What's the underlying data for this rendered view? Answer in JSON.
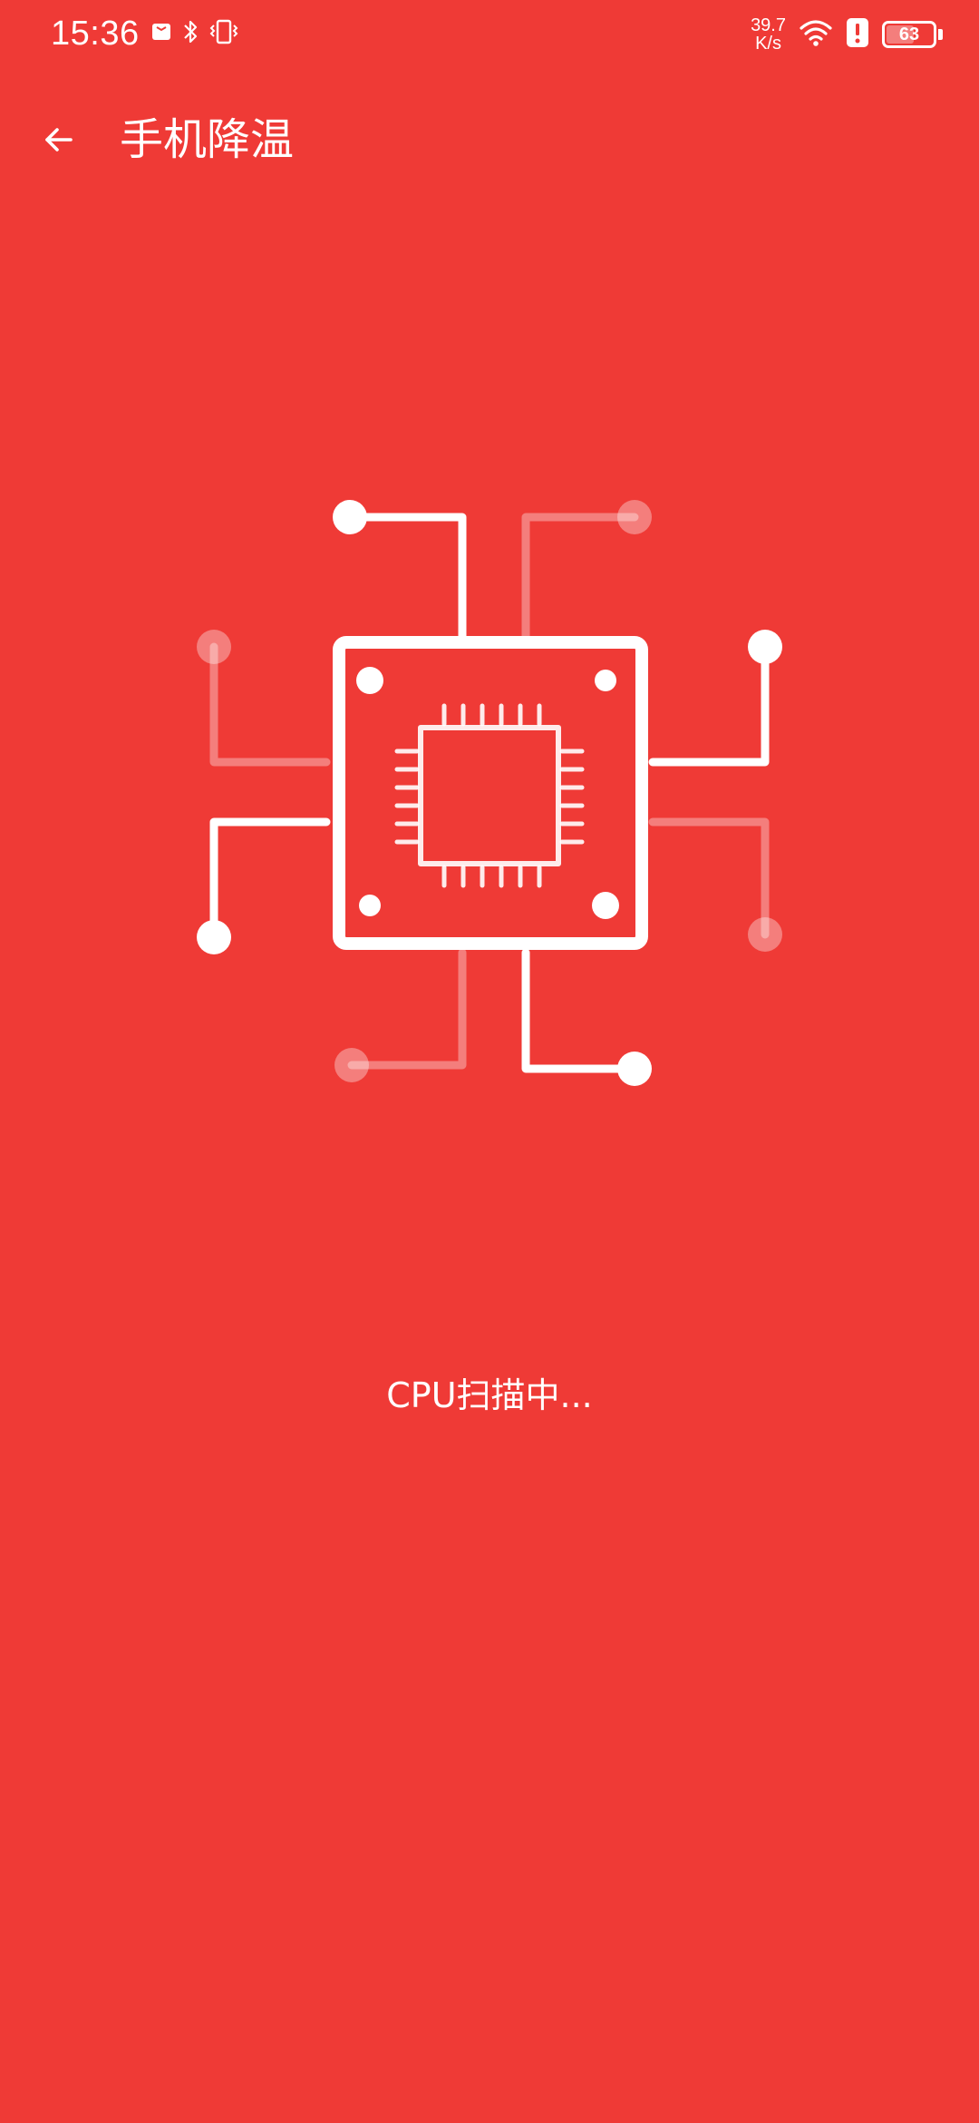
{
  "status_bar": {
    "time": "15:36",
    "net_speed_value": "39.7",
    "net_speed_unit": "K/s",
    "battery_level": "63",
    "icons": [
      "notification-icon",
      "bluetooth-icon",
      "vibrate-icon",
      "wifi-icon",
      "alert-icon",
      "battery-icon"
    ]
  },
  "header": {
    "title": "手机降温",
    "back_icon": "arrow-left-icon"
  },
  "main": {
    "illustration": "cpu-chip-icon",
    "scan_status": "CPU扫描中..."
  },
  "colors": {
    "background": "#ef3a36",
    "foreground": "#ffffff"
  }
}
